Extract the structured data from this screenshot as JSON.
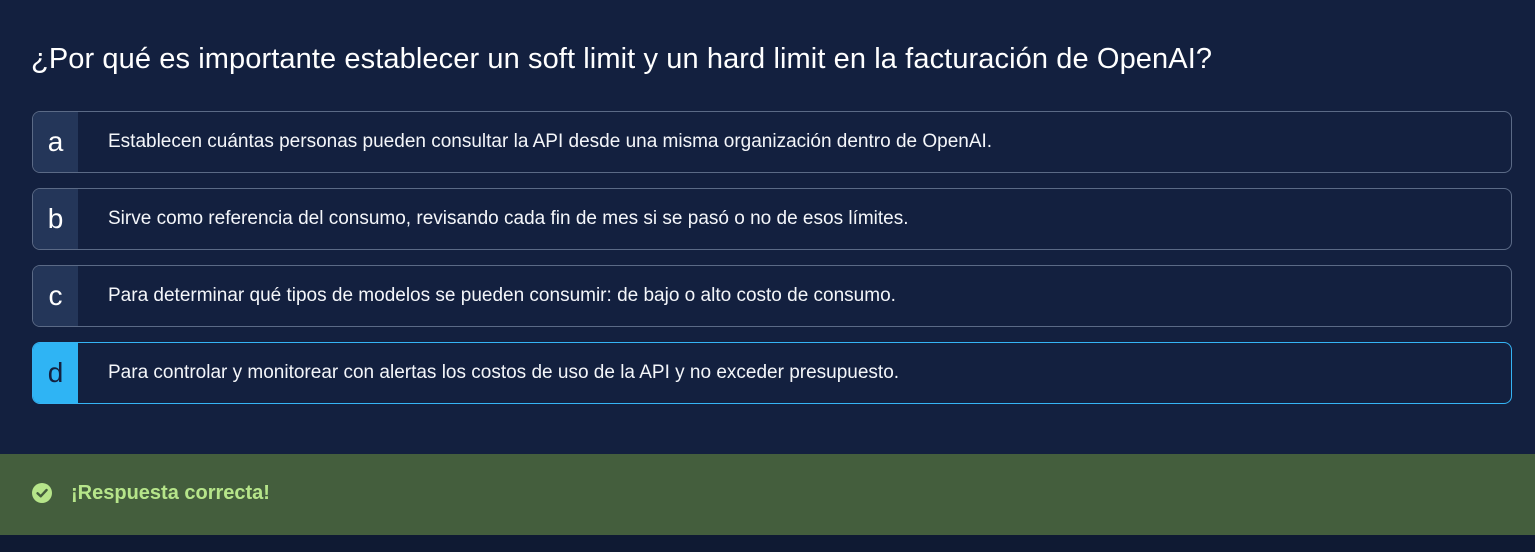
{
  "question": {
    "text": "¿Por qué es importante establecer un soft limit y un hard limit en la facturación de OpenAI?"
  },
  "options": [
    {
      "letter": "a",
      "text": "Establecen cuántas personas pueden consultar la API desde una misma organización dentro de OpenAI.",
      "selected": false
    },
    {
      "letter": "b",
      "text": "Sirve como referencia del consumo, revisando cada fin de mes si se pasó o no de esos límites.",
      "selected": false
    },
    {
      "letter": "c",
      "text": "Para determinar qué tipos de modelos se pueden consumir: de bajo o alto costo de consumo.",
      "selected": false
    },
    {
      "letter": "d",
      "text": "Para controlar y monitorear con alertas los costos de uso de la API y no exceder presupuesto.",
      "selected": true
    }
  ],
  "feedback": {
    "icon": "check-circle-icon",
    "message": "¡Respuesta correcta!",
    "status": "correct"
  },
  "colors": {
    "background": "#13203f",
    "option_border": "#5b6a86",
    "letter_bg": "#243659",
    "selected_accent": "#2fb4f4",
    "success_bg": "#445e3d",
    "success_text": "#b6e58a"
  }
}
